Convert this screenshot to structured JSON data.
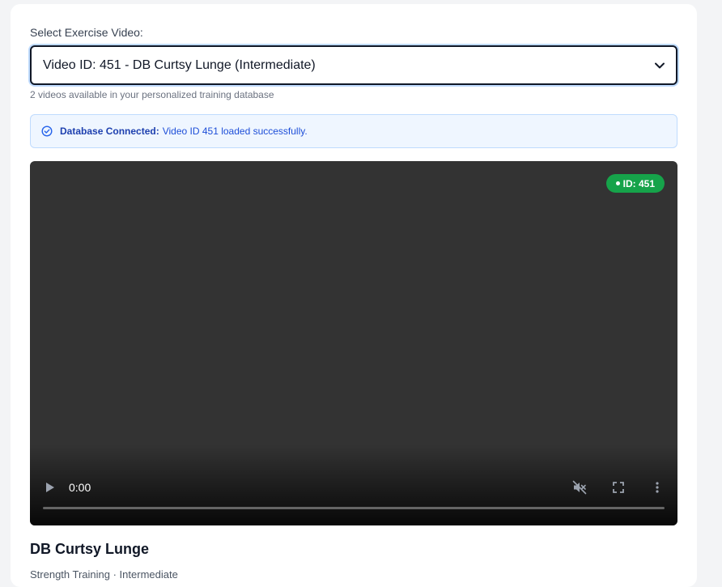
{
  "selector": {
    "label": "Select Exercise Video:",
    "selected": "Video ID: 451 - DB Curtsy Lunge (Intermediate)",
    "hint": "2 videos available in your personalized training database"
  },
  "alert": {
    "strong": "Database Connected:",
    "message": "Video ID 451 loaded successfully."
  },
  "video": {
    "badge": "ID: 451",
    "time": "0:00",
    "progress_fraction": 0
  },
  "exercise": {
    "title": "DB Curtsy Lunge",
    "subtitle": "Strength Training · Intermediate"
  },
  "colors": {
    "accent": "#2563eb",
    "badge_green": "#16a34a",
    "alert_bg": "#eff6ff"
  }
}
